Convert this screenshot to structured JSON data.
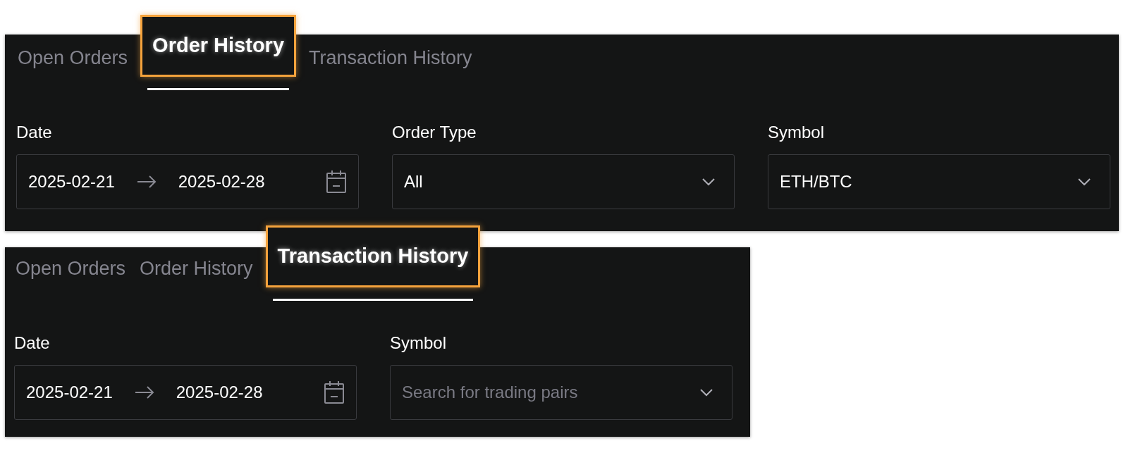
{
  "panels": [
    {
      "tabs": [
        {
          "label": "Open Orders",
          "selected": false
        },
        {
          "label": "Order History",
          "selected": true
        },
        {
          "label": "Transaction History",
          "selected": false
        }
      ],
      "filters": [
        {
          "kind": "date-range",
          "label": "Date",
          "start": "2025-02-21",
          "end": "2025-02-28"
        },
        {
          "kind": "select",
          "label": "Order Type",
          "value": "All"
        },
        {
          "kind": "select",
          "label": "Symbol",
          "value": "ETH/BTC"
        }
      ]
    },
    {
      "tabs": [
        {
          "label": "Open Orders",
          "selected": false
        },
        {
          "label": "Order History",
          "selected": false
        },
        {
          "label": "Transaction History",
          "selected": true
        }
      ],
      "filters": [
        {
          "kind": "date-range",
          "label": "Date",
          "start": "2025-02-21",
          "end": "2025-02-28"
        },
        {
          "kind": "select",
          "label": "Symbol",
          "placeholder": "Search for trading pairs"
        }
      ]
    }
  ]
}
